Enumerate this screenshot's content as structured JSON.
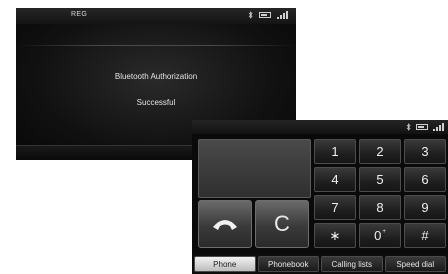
{
  "bt_screen": {
    "mode_label": "REG",
    "title": "Bluetooth Authorization",
    "message": "Successful"
  },
  "phone_screen": {
    "status_icons": [
      "bluetooth-icon",
      "battery-icon",
      "signal-icon"
    ],
    "display_text": "",
    "call_button_icon": "phone-handset-icon",
    "clear_label": "C",
    "keys": [
      {
        "main": "1",
        "sub": ""
      },
      {
        "main": "2",
        "sub": ""
      },
      {
        "main": "3",
        "sub": ""
      },
      {
        "main": "4",
        "sub": ""
      },
      {
        "main": "5",
        "sub": ""
      },
      {
        "main": "6",
        "sub": ""
      },
      {
        "main": "7",
        "sub": ""
      },
      {
        "main": "8",
        "sub": ""
      },
      {
        "main": "9",
        "sub": ""
      },
      {
        "main": "∗",
        "sub": ""
      },
      {
        "main": "0",
        "sub": "+"
      },
      {
        "main": "#",
        "sub": ""
      }
    ],
    "tabs": [
      {
        "label": "Phone",
        "active": true
      },
      {
        "label": "Phonebook",
        "active": false
      },
      {
        "label": "Calling lists",
        "active": false
      },
      {
        "label": "Speed dial",
        "active": false
      }
    ]
  },
  "colors": {
    "background": "#0b0b0b",
    "key_text": "#f0f0f0",
    "active_tab": "#d9d9d9"
  }
}
